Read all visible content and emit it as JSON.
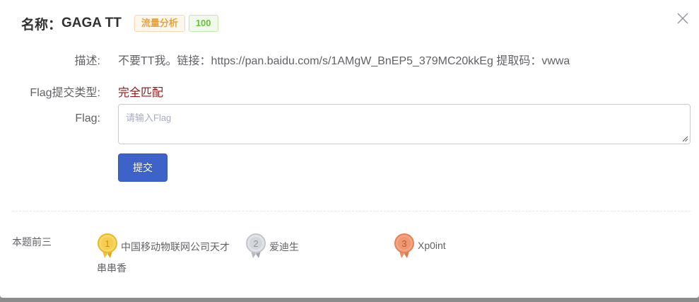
{
  "header": {
    "title_prefix": "名称：",
    "title_name": "GAGA TT",
    "category_tag": "流量分析",
    "score_tag": "100"
  },
  "fields": {
    "description_label": "描述:",
    "description_value": "不要TT我。链接：https://pan.baidu.com/s/1AMgW_BnEP5_379MC20kkEg 提取码：vwwa",
    "flag_type_label": "Flag提交类型:",
    "flag_type_value": "完全匹配",
    "flag_label": "Flag:",
    "flag_placeholder": "请输入Flag",
    "submit_label": "提交"
  },
  "top_three": {
    "label": "本题前三",
    "ranks": [
      {
        "place": "1",
        "name_line1": "中国移动物联网公司天才",
        "name_line2": "串串香",
        "medal": "gold-medal-icon"
      },
      {
        "place": "2",
        "name_line1": "爱迪生",
        "medal": "silver-medal-icon"
      },
      {
        "place": "3",
        "name_line1": "Xp0int",
        "medal": "bronze-medal-icon"
      }
    ]
  },
  "colors": {
    "primary": "#3d63c9",
    "warning": "#e6a23c",
    "success": "#67c23a",
    "flag_type": "#8b1a1a"
  }
}
